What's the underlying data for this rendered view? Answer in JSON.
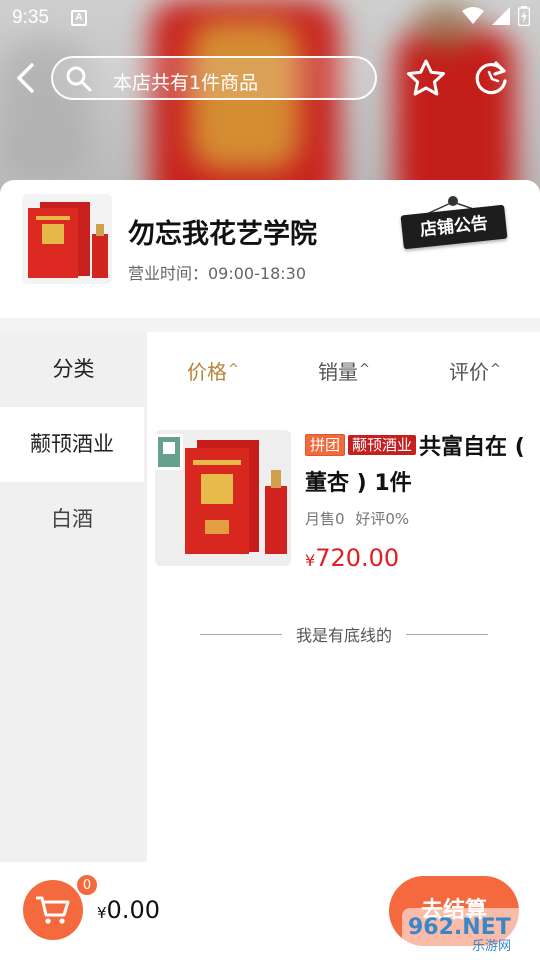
{
  "status_bar": {
    "time": "9:35",
    "sim_letter": "A"
  },
  "header": {
    "search_text": "本店共有1件商品"
  },
  "store": {
    "name": "勿忘我花艺学院",
    "hours": "营业时间：09:00-18:30",
    "notice_label": "店铺公告"
  },
  "categories": {
    "title": "分类",
    "items": [
      {
        "label": "颟顸酒业",
        "active": true
      },
      {
        "label": "白酒",
        "active": false
      }
    ]
  },
  "sort": {
    "price": "价格",
    "sales": "销量",
    "rating": "评价",
    "caret": "^"
  },
  "products": [
    {
      "tag_group": "拼团",
      "tag_category": "颟顸酒业",
      "title": "共富自在 ( 董杏 ) 1件",
      "monthly_sales": "月售0",
      "good_rate": "好评0%",
      "currency": "¥",
      "price": "720.00"
    }
  ],
  "end_text": "我是有底线的",
  "cart": {
    "badge": "0",
    "currency": "¥",
    "total": "0.00",
    "checkout_label": "去结算"
  },
  "watermark": {
    "text": "962.NET",
    "subtext": "乐游网"
  },
  "colors": {
    "accent": "#f46a3e",
    "price": "#e02020",
    "sort_active": "#b8843a",
    "tag_red": "#c61f1f"
  }
}
